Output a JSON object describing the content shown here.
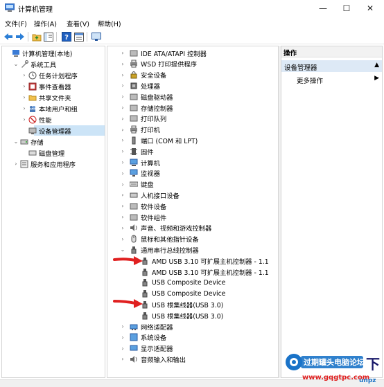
{
  "window": {
    "title": "计算机管理",
    "minimize_glyph": "—",
    "maximize_glyph": "☐",
    "close_glyph": "✕"
  },
  "menu": [
    {
      "label": "文件(F)"
    },
    {
      "label": "操作(A)"
    },
    {
      "label": "查看(V)"
    },
    {
      "label": "帮助(H)"
    }
  ],
  "toolbar": {
    "icons": [
      "back-icon",
      "forward-icon",
      "up-folder-icon",
      "show-hide-tree-icon",
      "help-icon",
      "properties-icon",
      "monitor-icon"
    ]
  },
  "left_tree": [
    {
      "label": "计算机管理(本地)",
      "icon": "computer-management-icon",
      "level": 0,
      "expander": ""
    },
    {
      "label": "系统工具",
      "icon": "tools-icon",
      "level": 1,
      "expander": "v"
    },
    {
      "label": "任务计划程序",
      "icon": "clock-icon",
      "level": 2,
      "expander": ">"
    },
    {
      "label": "事件查看器",
      "icon": "event-viewer-icon",
      "level": 2,
      "expander": ">"
    },
    {
      "label": "共享文件夹",
      "icon": "shared-folder-icon",
      "level": 2,
      "expander": ">"
    },
    {
      "label": "本地用户和组",
      "icon": "users-icon",
      "level": 2,
      "expander": ">"
    },
    {
      "label": "性能",
      "icon": "performance-icon",
      "level": 2,
      "expander": ">"
    },
    {
      "label": "设备管理器",
      "icon": "device-manager-icon",
      "level": 2,
      "expander": "",
      "selected": true
    },
    {
      "label": "存储",
      "icon": "storage-icon",
      "level": 1,
      "expander": "v"
    },
    {
      "label": "磁盘管理",
      "icon": "disk-icon",
      "level": 2,
      "expander": ""
    },
    {
      "label": "服务和应用程序",
      "icon": "services-icon",
      "level": 1,
      "expander": ">"
    }
  ],
  "device_tree": [
    {
      "label": "IDE ATA/ATAPI 控制器",
      "icon": "ide-icon",
      "expander": ">"
    },
    {
      "label": "WSD 打印提供程序",
      "icon": "printer-icon",
      "expander": ">"
    },
    {
      "label": "安全设备",
      "icon": "security-icon",
      "expander": ">"
    },
    {
      "label": "处理器",
      "icon": "processor-icon",
      "expander": ">"
    },
    {
      "label": "磁盘驱动器",
      "icon": "disk-drive-icon",
      "expander": ">"
    },
    {
      "label": "存储控制器",
      "icon": "storage-controller-icon",
      "expander": ">"
    },
    {
      "label": "打印队列",
      "icon": "print-queue-icon",
      "expander": ">"
    },
    {
      "label": "打印机",
      "icon": "printer-icon",
      "expander": ">"
    },
    {
      "label": "端口 (COM 和 LPT)",
      "icon": "port-icon",
      "expander": ">"
    },
    {
      "label": "固件",
      "icon": "firmware-icon",
      "expander": ">"
    },
    {
      "label": "计算机",
      "icon": "computer-icon",
      "expander": ">"
    },
    {
      "label": "监视器",
      "icon": "monitor-icon",
      "expander": ">"
    },
    {
      "label": "键盘",
      "icon": "keyboard-icon",
      "expander": ">"
    },
    {
      "label": "人机接口设备",
      "icon": "hid-icon",
      "expander": ">"
    },
    {
      "label": "软件设备",
      "icon": "software-device-icon",
      "expander": ">"
    },
    {
      "label": "软件组件",
      "icon": "software-component-icon",
      "expander": ">"
    },
    {
      "label": "声音、视频和游戏控制器",
      "icon": "sound-icon",
      "expander": ">"
    },
    {
      "label": "鼠标和其他指针设备",
      "icon": "mouse-icon",
      "expander": ">"
    },
    {
      "label": "通用串行总线控制器",
      "icon": "usb-icon",
      "expander": "v"
    },
    {
      "label": "AMD USB 3.10 可扩展主机控制器 - 1.1",
      "icon": "usb-icon",
      "expander": "",
      "child": true
    },
    {
      "label": "AMD USB 3.10 可扩展主机控制器 - 1.1",
      "icon": "usb-icon",
      "expander": "",
      "child": true
    },
    {
      "label": "USB Composite Device",
      "icon": "usb-icon",
      "expander": "",
      "child": true
    },
    {
      "label": "USB Composite Device",
      "icon": "usb-icon",
      "expander": "",
      "child": true
    },
    {
      "label": "USB 根集线器(USB 3.0)",
      "icon": "usb-icon",
      "expander": "",
      "child": true
    },
    {
      "label": "USB 根集线器(USB 3.0)",
      "icon": "usb-icon",
      "expander": "",
      "child": true
    },
    {
      "label": "网络适配器",
      "icon": "network-adapter-icon",
      "expander": ">"
    },
    {
      "label": "系统设备",
      "icon": "system-device-icon",
      "expander": ">"
    },
    {
      "label": "显示适配器",
      "icon": "display-adapter-icon",
      "expander": ">"
    },
    {
      "label": "音频输入和输出",
      "icon": "audio-icon",
      "expander": ">"
    }
  ],
  "actions": {
    "header": "操作",
    "section": "设备管理器",
    "more": "更多操作"
  },
  "watermark": {
    "brand": "过期罐头电脑论坛",
    "url": "www.gqgtpc.com",
    "corner": "下",
    "corner2": "unpz"
  },
  "colors": {
    "selection": "#cce4f7",
    "arrow_red": "#e02020",
    "accent_blue": "#1a73c8"
  }
}
